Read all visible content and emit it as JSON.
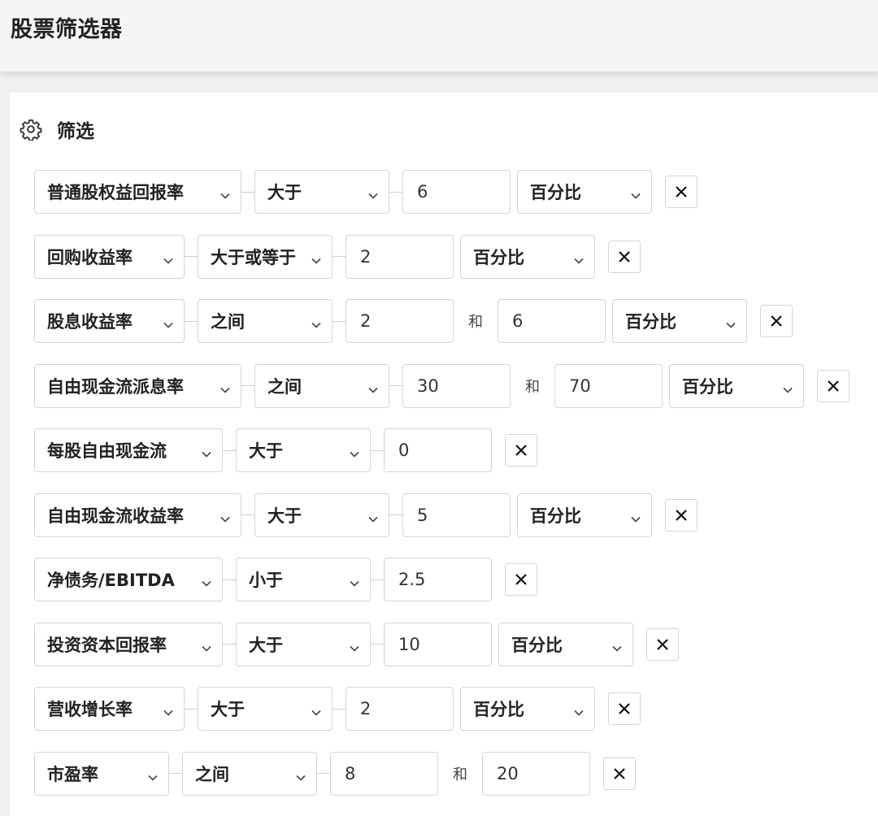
{
  "header": {
    "title": "股票筛选器"
  },
  "panel": {
    "title": "筛选",
    "icon": "gear-icon"
  },
  "and_label": "和",
  "filters": [
    {
      "metric": "普通股权益回报率",
      "operator": "大于",
      "value1": "6",
      "unit": "百分比"
    },
    {
      "metric": "回购收益率",
      "operator": "大于或等于",
      "value1": "2",
      "unit": "百分比"
    },
    {
      "metric": "股息收益率",
      "operator": "之间",
      "value1": "2",
      "value2": "6",
      "unit": "百分比"
    },
    {
      "metric": "自由现金流派息率",
      "operator": "之间",
      "value1": "30",
      "value2": "70",
      "unit": "百分比"
    },
    {
      "metric": "每股自由现金流",
      "operator": "大于",
      "value1": "0"
    },
    {
      "metric": "自由现金流收益率",
      "operator": "大于",
      "value1": "5",
      "unit": "百分比"
    },
    {
      "metric": "净债务/EBITDA",
      "operator": "小于",
      "value1": "2.5"
    },
    {
      "metric": "投资资本回报率",
      "operator": "大于",
      "value1": "10",
      "unit": "百分比"
    },
    {
      "metric": "营收增长率",
      "operator": "大于",
      "value1": "2",
      "unit": "百分比"
    },
    {
      "metric": "市盈率",
      "operator": "之间",
      "value1": "8",
      "value2": "20"
    }
  ]
}
